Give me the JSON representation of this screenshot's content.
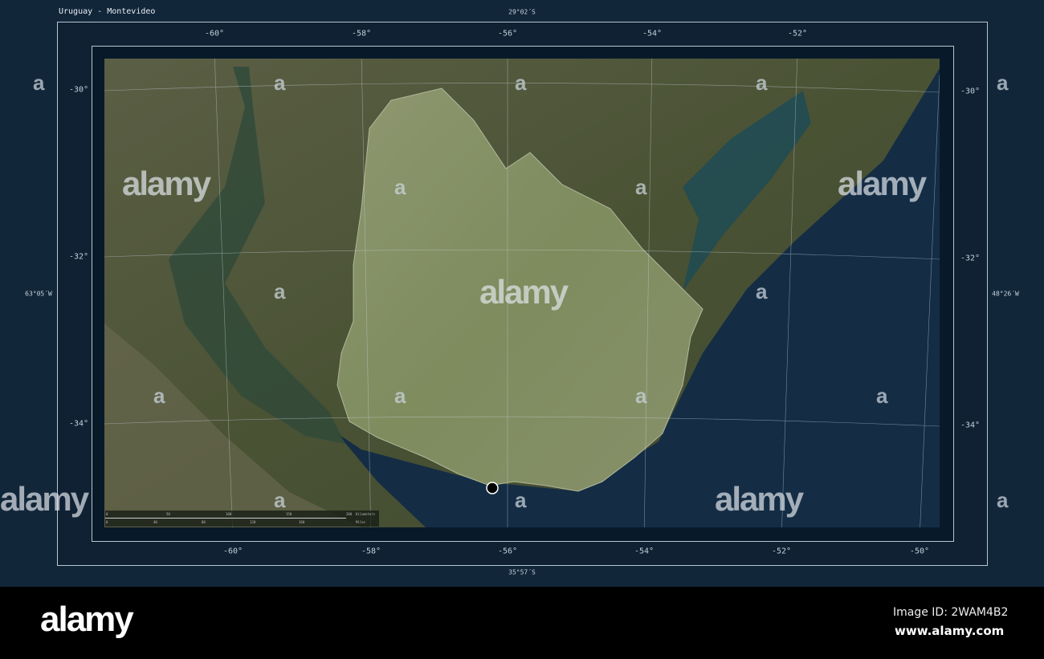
{
  "title": "Uruguay - Montevideo",
  "bounds": {
    "north": "29°02´S",
    "south": "35°57´S",
    "west": "63°05´W",
    "east": "48°26´W"
  },
  "top_longitudes": [
    "-60°",
    "-58°",
    "-56°",
    "-54°",
    "-52°"
  ],
  "bottom_longitudes": [
    "-60°",
    "-58°",
    "-56°",
    "-54°",
    "-52°",
    "-50°"
  ],
  "left_latitudes": [
    "-30°",
    "-32°",
    "-34°"
  ],
  "right_latitudes": [
    "-30°",
    "-32°",
    "-34°"
  ],
  "scale_bar": {
    "km_ticks": [
      "0",
      "50",
      "100",
      "150",
      "200"
    ],
    "km_unit": "Kilometers",
    "mi_ticks": [
      "0",
      "40",
      "80",
      "120",
      "160"
    ],
    "mi_unit": "Miles"
  },
  "marker": {
    "name": "Montevideo",
    "color": "#000000"
  },
  "watermark": "alamy",
  "watermark_glyph": "a",
  "banner": {
    "logo": "alamy",
    "image_id": "Image ID: 2WAM4B2",
    "url": "www.alamy.com"
  }
}
